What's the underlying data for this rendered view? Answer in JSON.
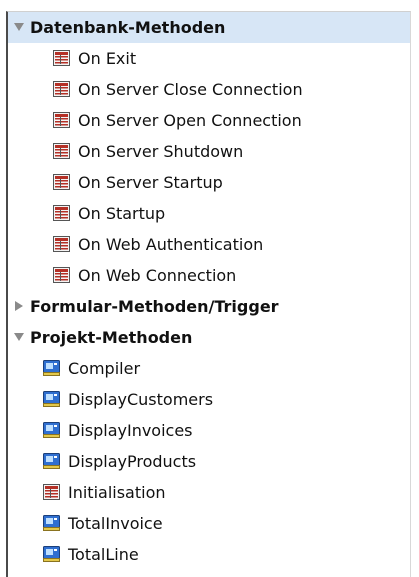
{
  "colors": {
    "selection": "#d7e6f6",
    "twisty": "#8a8a8a",
    "database_method_icon": "#b53026",
    "project_method_icon": "#2f6fd0"
  },
  "tree": {
    "groups": [
      {
        "label": "Datenbank-Methoden",
        "expanded": true,
        "selected": true,
        "items": [
          {
            "label": "On Exit",
            "icon": "database-method-icon"
          },
          {
            "label": "On Server Close Connection",
            "icon": "database-method-icon"
          },
          {
            "label": "On Server Open Connection",
            "icon": "database-method-icon"
          },
          {
            "label": "On Server Shutdown",
            "icon": "database-method-icon"
          },
          {
            "label": "On Server Startup",
            "icon": "database-method-icon"
          },
          {
            "label": "On Startup",
            "icon": "database-method-icon"
          },
          {
            "label": "On Web Authentication",
            "icon": "database-method-icon"
          },
          {
            "label": "On Web Connection",
            "icon": "database-method-icon"
          }
        ]
      },
      {
        "label": "Formular-Methoden/Trigger",
        "expanded": false,
        "selected": false,
        "items": []
      },
      {
        "label": "Projekt-Methoden",
        "expanded": true,
        "selected": false,
        "items": [
          {
            "label": "Compiler",
            "icon": "project-method-icon"
          },
          {
            "label": "DisplayCustomers",
            "icon": "project-method-icon"
          },
          {
            "label": "DisplayInvoices",
            "icon": "project-method-icon"
          },
          {
            "label": "DisplayProducts",
            "icon": "project-method-icon"
          },
          {
            "label": "Initialisation",
            "icon": "database-method-icon"
          },
          {
            "label": "TotalInvoice",
            "icon": "project-method-icon"
          },
          {
            "label": "TotalLine",
            "icon": "project-method-icon"
          }
        ]
      }
    ]
  }
}
